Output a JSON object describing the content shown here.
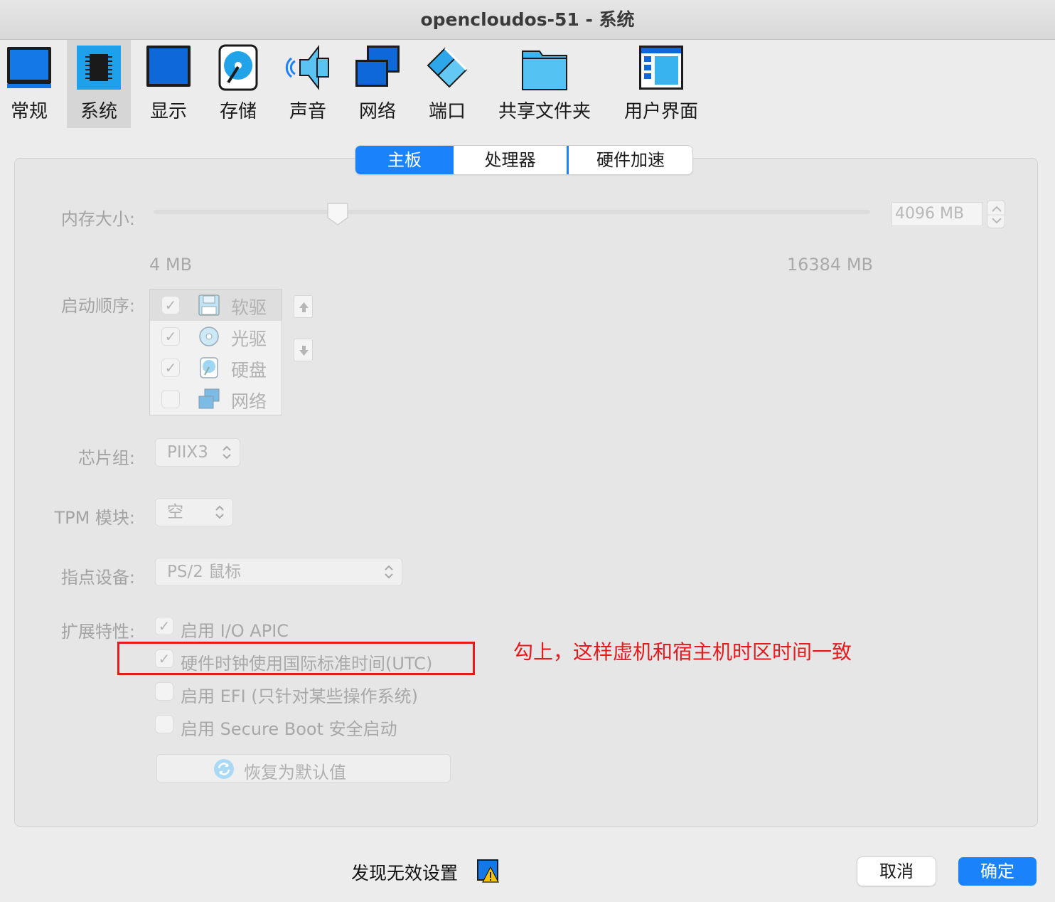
{
  "window": {
    "title": "opencloudos-51 - 系统"
  },
  "toolbar": {
    "items": [
      {
        "label": "常规",
        "icon": "monitor-icon"
      },
      {
        "label": "系统",
        "icon": "chip-icon",
        "selected": true
      },
      {
        "label": "显示",
        "icon": "display-icon"
      },
      {
        "label": "存储",
        "icon": "storage-disk-icon"
      },
      {
        "label": "声音",
        "icon": "speaker-icon"
      },
      {
        "label": "网络",
        "icon": "network-icon"
      },
      {
        "label": "端口",
        "icon": "port-icon"
      },
      {
        "label": "共享文件夹",
        "icon": "folder-icon"
      },
      {
        "label": "用户界面",
        "icon": "user-interface-icon"
      }
    ]
  },
  "tabs": [
    {
      "label": "主板",
      "active": true
    },
    {
      "label": "处理器"
    },
    {
      "label": "硬件加速"
    }
  ],
  "memory": {
    "label": "内存大小:",
    "value": "4096 MB",
    "slider_fraction": 0.25,
    "min_label": "4 MB",
    "max_label": "16384 MB"
  },
  "boot_order": {
    "label": "启动顺序:",
    "items": [
      {
        "label": "软驱",
        "checked": true,
        "icon": "floppy-icon"
      },
      {
        "label": "光驱",
        "checked": true,
        "icon": "optical-disc-icon"
      },
      {
        "label": "硬盘",
        "checked": true,
        "icon": "hard-disk-icon"
      },
      {
        "label": "网络",
        "checked": false,
        "icon": "network-icon"
      }
    ]
  },
  "chipset": {
    "label": "芯片组:",
    "value": "PIIX3"
  },
  "tpm": {
    "label": "TPM 模块:",
    "value": "空"
  },
  "pointing": {
    "label": "指点设备:",
    "value": "PS/2 鼠标"
  },
  "extended": {
    "label": "扩展特性:",
    "options": [
      {
        "label": "启用 I/O APIC",
        "checked": true
      },
      {
        "label": "硬件时钟使用国际标准时间(UTC)",
        "checked": true
      },
      {
        "label": "启用 EFI (只针对某些操作系统)",
        "checked": false
      },
      {
        "label": "启用 Secure Boot 安全启动",
        "checked": false
      }
    ]
  },
  "restore_button": "恢复为默认值",
  "annotation": "勾上，这样虚机和宿主机时区时间一致",
  "footer": {
    "warning": "发现无效设置",
    "cancel": "取消",
    "ok": "确定"
  },
  "colors": {
    "accent": "#1a82fb",
    "annotation": "#e61a1a"
  }
}
